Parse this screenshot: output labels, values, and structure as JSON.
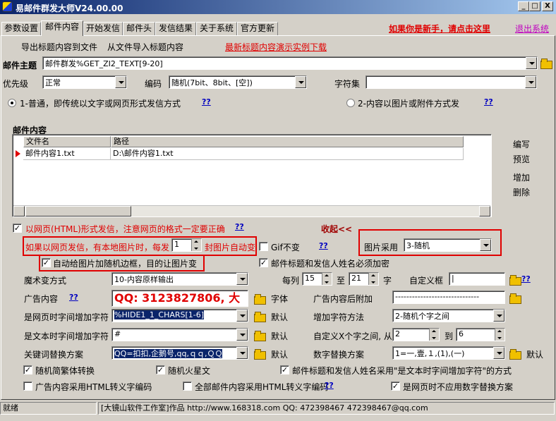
{
  "window": {
    "title": "易邮件群发大师V24.00.00",
    "min": "_",
    "max": "□",
    "close": "X"
  },
  "tabs": [
    "参数设置",
    "邮件内容",
    "开始发信",
    "邮件头",
    "发信结果",
    "关于系统",
    "官方更新"
  ],
  "header_links": {
    "newbie": "如果你是新手，请点击这里",
    "exit": "退出系统"
  },
  "toolbar": {
    "export": "导出标题内容到文件",
    "import": "从文件导入标题内容",
    "demo": "最新标题内容演示实例下载"
  },
  "subject": {
    "label": "邮件主题",
    "value": "邮件群发%GET_ZI2_TEXT[9-20]"
  },
  "priority": {
    "label": "优先级",
    "value": "正常"
  },
  "encoding": {
    "label": "编码",
    "value": "随机(7bit、8bit、[空])"
  },
  "charset": {
    "label": "字符集",
    "value": ""
  },
  "modes": {
    "normal": "1-普通，即传统以文字或网页形式发信方式",
    "q1": "??",
    "image": "2-内容以图片或附件方式发",
    "q2": "??"
  },
  "content": {
    "label": "邮件内容",
    "columns": [
      "文件名",
      "路径"
    ],
    "rows": [
      {
        "name": "邮件内容1.txt",
        "path": "D:\\邮件内容1.txt"
      }
    ],
    "side_buttons": [
      "编写",
      "预览",
      "增加",
      "删除"
    ]
  },
  "html_send": {
    "text": "以网页(HTML)形式发信，注意网页的格式一定要正确",
    "q": "??",
    "collapse": "收起<<"
  },
  "local_images": {
    "prefix": "如果以网页发信，有本地图片时，每发",
    "count": "1",
    "suffix": "封图片自动变",
    "gif": "Gif不变",
    "q": "??",
    "adopt_label": "图片采用",
    "adopt_value": "3-随机"
  },
  "auto_border": "自动给图片加随机边框，目的让图片变",
  "encrypt": "邮件标题和发信人姓名必须加密",
  "magic": {
    "label": "魔术变方式",
    "value": "10-内容原样输出",
    "per": "每列",
    "from": "15",
    "to_label": "至",
    "to": "21",
    "unit": "字",
    "custom_frame": "自定义框",
    "custom_value": "|",
    "q": "??"
  },
  "ad": {
    "label": "广告内容",
    "q": "??",
    "value": "QQ: 3123827806, 大",
    "font": "字体",
    "append_label": "广告内容后附加",
    "append_value": "------------------------------"
  },
  "web_add": {
    "label": "是网页时字间增加字符",
    "value": "%HIDE1_1_CHARS[1-6]",
    "default": "默认",
    "method_label": "增加字符方法",
    "method_value": "2-随机个字之间"
  },
  "text_add": {
    "label": "是文本时字间增加字符",
    "value": "#",
    "default": "默认",
    "custom_label": "自定义X个字之间, 从",
    "from": "2",
    "to_label": "到",
    "to": "6"
  },
  "keyword": {
    "label": "关键词替换方案",
    "value": "QQ=扣扣,企鹅号,qq,ｑｑ,ＱＱ",
    "default": "默认",
    "num_label": "数字替换方案",
    "num_value": "1=一,壹,１,(1),(一)",
    "num_default": "默认"
  },
  "options": {
    "trad": "随机简繁体转换",
    "stars": "随机火星文",
    "title_text": "邮件标题和发信人姓名采用\"是文本时字间增加字符\"的方式",
    "ad_html": "广告内容采用HTML转义字编码",
    "all_html": "全部邮件内容采用HTML转义字编码",
    "all_q": "??",
    "no_num": "是网页时不应用数字替换方案"
  },
  "status": {
    "ready": "就绪",
    "info": "[大镜山软件工作室]作品 http://www.168318.com QQ: 472398467 472398467@qq.com"
  }
}
